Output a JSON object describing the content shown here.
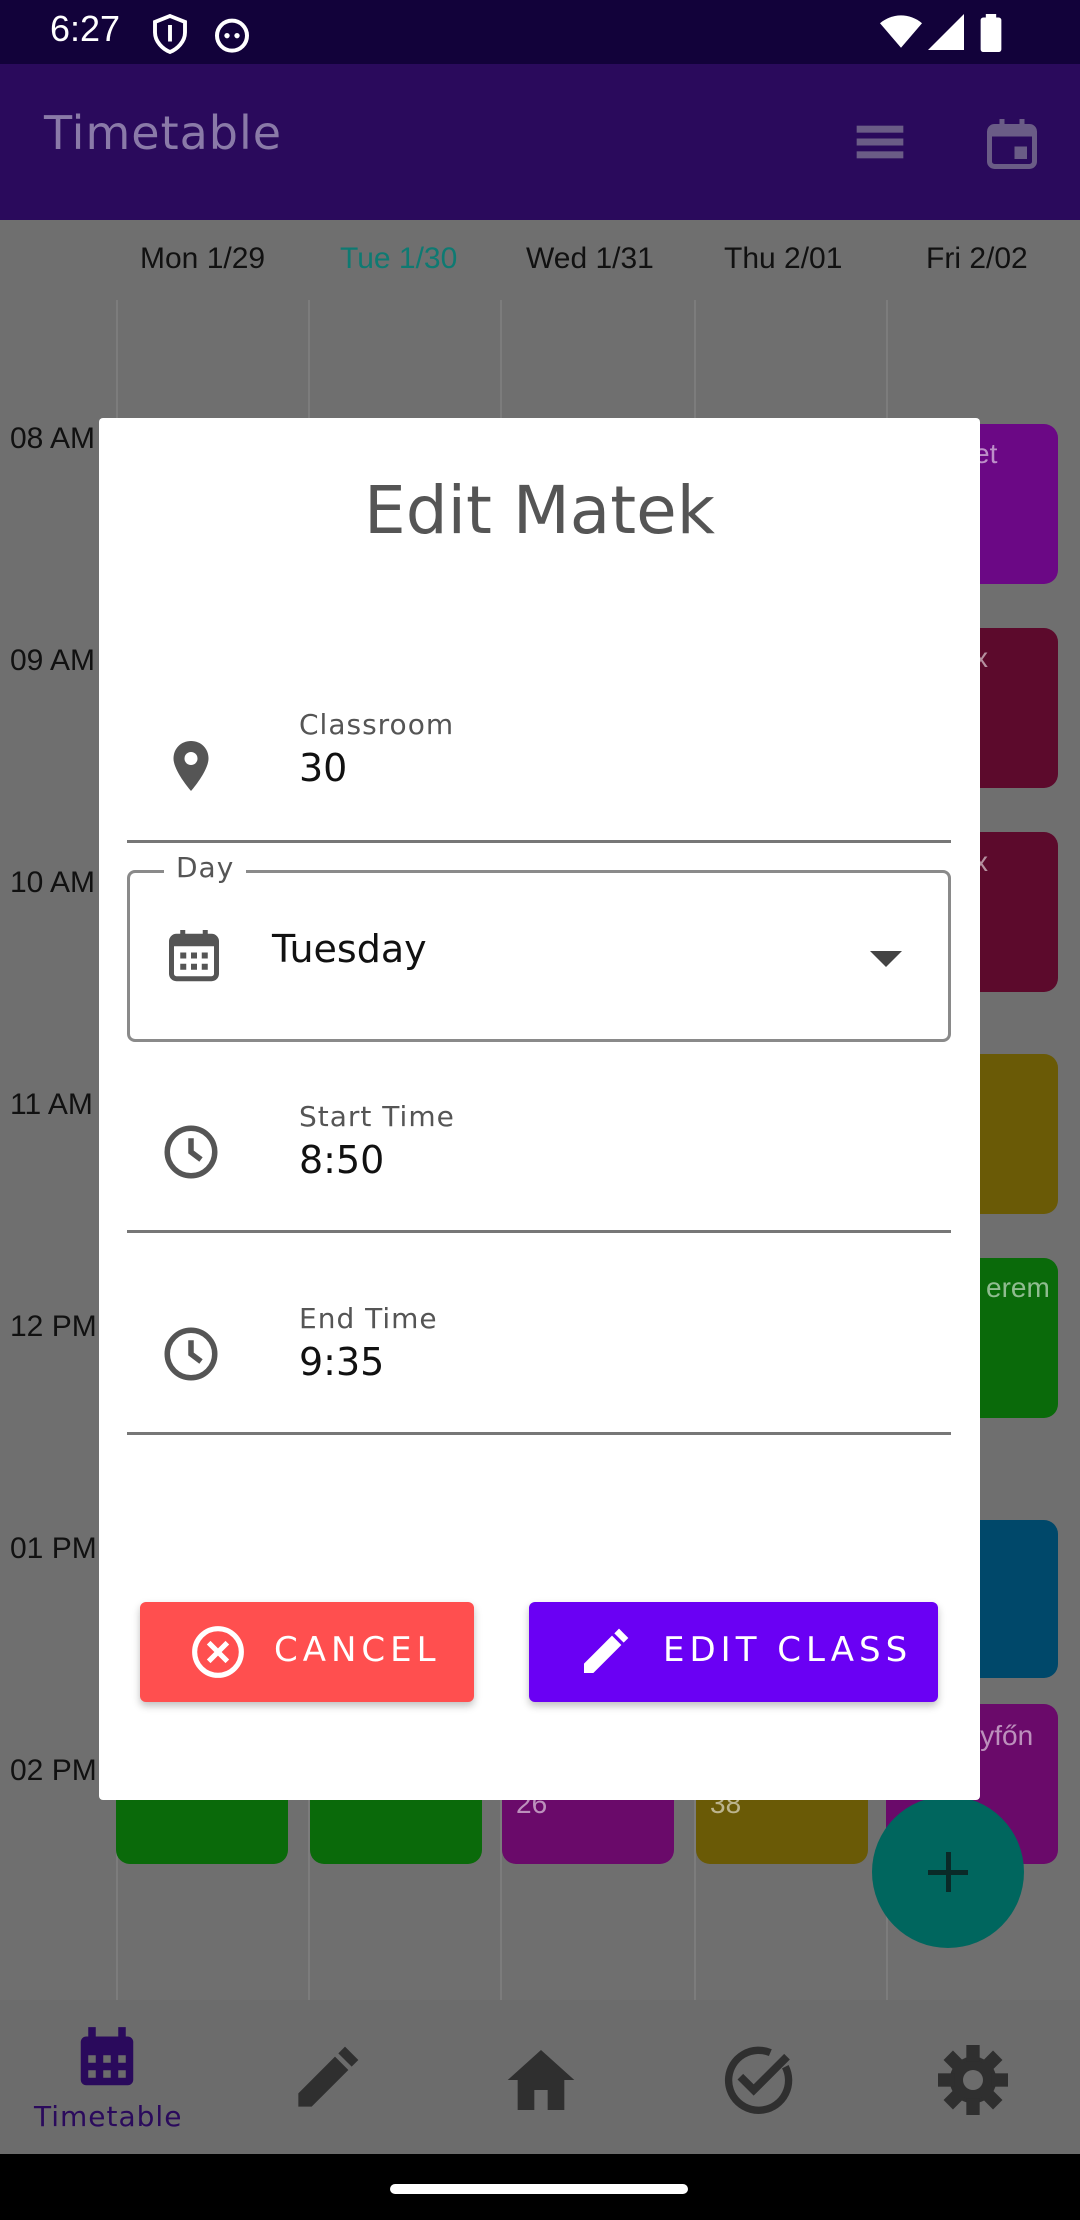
{
  "status_bar": {
    "time": "6:27",
    "icons": [
      "shield-icon",
      "cat-icon",
      "wifi-icon",
      "signal-icon",
      "battery-icon"
    ]
  },
  "app_bar": {
    "title": "Timetable",
    "actions": [
      "view-toggle-icon",
      "calendar-today-icon"
    ]
  },
  "week": {
    "days": [
      "Mon 1/29",
      "Tue 1/30",
      "Wed 1/31",
      "Thu 2/01",
      "Fri 2/02"
    ],
    "today": "Tue 1/30",
    "hours": [
      "08 AM",
      "09 AM",
      "10 AM",
      "11 AM",
      "12 PM",
      "01 PM",
      "02 PM"
    ],
    "visible_block_text": [
      "et",
      "x",
      "x",
      "erem",
      "lyfőn",
      "26",
      "38"
    ]
  },
  "dialog": {
    "title": "Edit Matek",
    "classroom": {
      "label": "Classroom",
      "value": "30"
    },
    "day": {
      "label": "Day",
      "value": "Tuesday"
    },
    "start_time": {
      "label": "Start Time",
      "value": "8:50"
    },
    "end_time": {
      "label": "End Time",
      "value": "9:35"
    },
    "cancel_label": "CANCEL",
    "edit_label": "EDIT CLASS"
  },
  "bottom_nav": {
    "items": [
      {
        "label": "Timetable",
        "icon": "calendar-icon",
        "selected": true
      },
      {
        "label": "",
        "icon": "pencil-icon"
      },
      {
        "label": "",
        "icon": "home-icon"
      },
      {
        "label": "",
        "icon": "check-circle-icon"
      },
      {
        "label": "",
        "icon": "settings-icon"
      }
    ]
  },
  "colors": {
    "primary": "#6a00f4",
    "app_bar": "#2a0a5c",
    "cancel": "#ff4f4f",
    "fab": "#00665e",
    "today": "#0e7a72"
  }
}
